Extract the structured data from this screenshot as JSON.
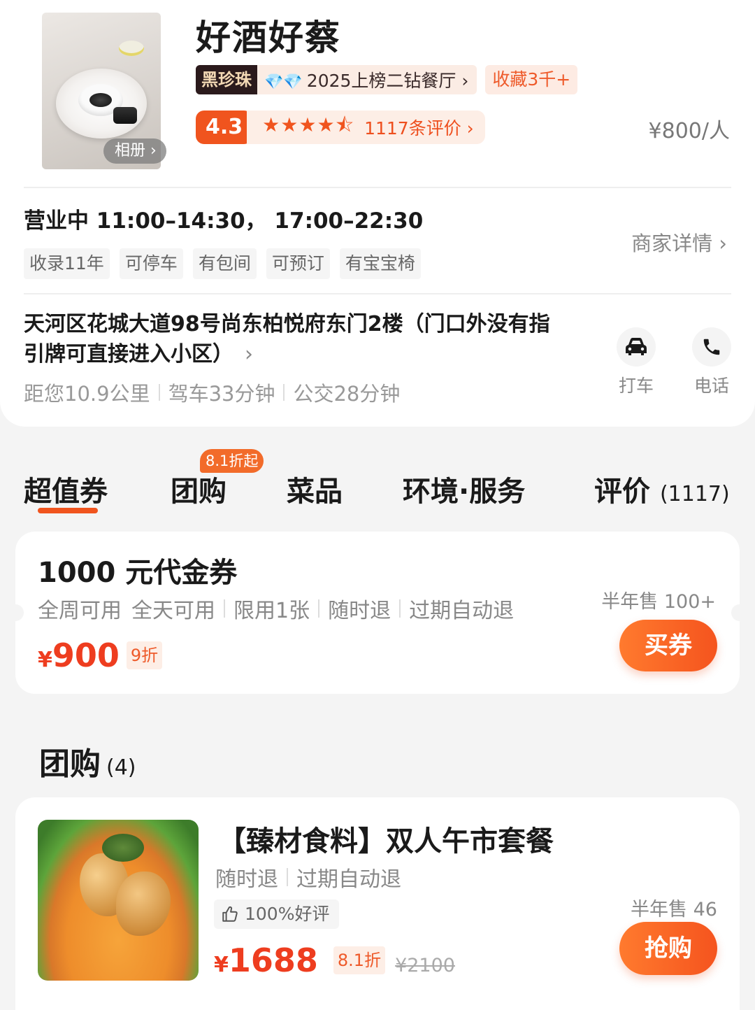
{
  "shop": {
    "album_label": "相册 ›",
    "name": "好酒好蔡",
    "pearl_label": "黑珍珠",
    "pearl_gems": "💎💎",
    "pearl_rank": "2025上榜二钻餐厅 ›",
    "favorites": "收藏3千+",
    "score": "4.3",
    "stars": "★★★★⯪",
    "rating_value": 4.3,
    "reviews": "1117条评价 ›",
    "price_per_person": "¥800/人"
  },
  "info": {
    "hours": "营业中 11:00–14:30， 17:00–22:30",
    "tags": [
      "收录11年",
      "可停车",
      "有包间",
      "可预订",
      "有宝宝椅"
    ],
    "detail_link": "商家详情 ›",
    "address": "天河区花城大道98号尚东柏悦府东门2楼（门口外没有指引牌可直接进入小区）",
    "address_arrow": "›",
    "distance": "距您10.9公里",
    "drive": "驾车33分钟",
    "bus": "公交28分钟",
    "taxi_label": "打车",
    "phone_label": "电话"
  },
  "tabs": {
    "items": [
      "超值券",
      "团购",
      "菜品",
      "环境·服务",
      "评价"
    ],
    "review_count": "(1117)",
    "group_badge": "8.1折起",
    "active": "超值券"
  },
  "voucher": {
    "title": "1000 元代金券",
    "terms_a": "全周可用",
    "terms_b": "全天可用",
    "terms_c": "限用1张",
    "terms_d": "随时退",
    "terms_e": "过期自动退",
    "yen": "¥",
    "price": "900",
    "discount": "9折",
    "sold": "半年售 100+",
    "button": "买券"
  },
  "group": {
    "title": "团购",
    "count": "(4)",
    "deal": {
      "name": "【臻材食料】双人午市套餐",
      "term_a": "随时退",
      "term_b": "过期自动退",
      "good_rate": "100%好评",
      "yen": "¥",
      "price": "1688",
      "discount": "8.1折",
      "original": "¥2100",
      "sold": "半年售 46",
      "button": "抢购"
    }
  },
  "colors": {
    "accent": "#f0541e",
    "price": "#ee3d1f",
    "pearl_bg": "#2b1a1c"
  }
}
